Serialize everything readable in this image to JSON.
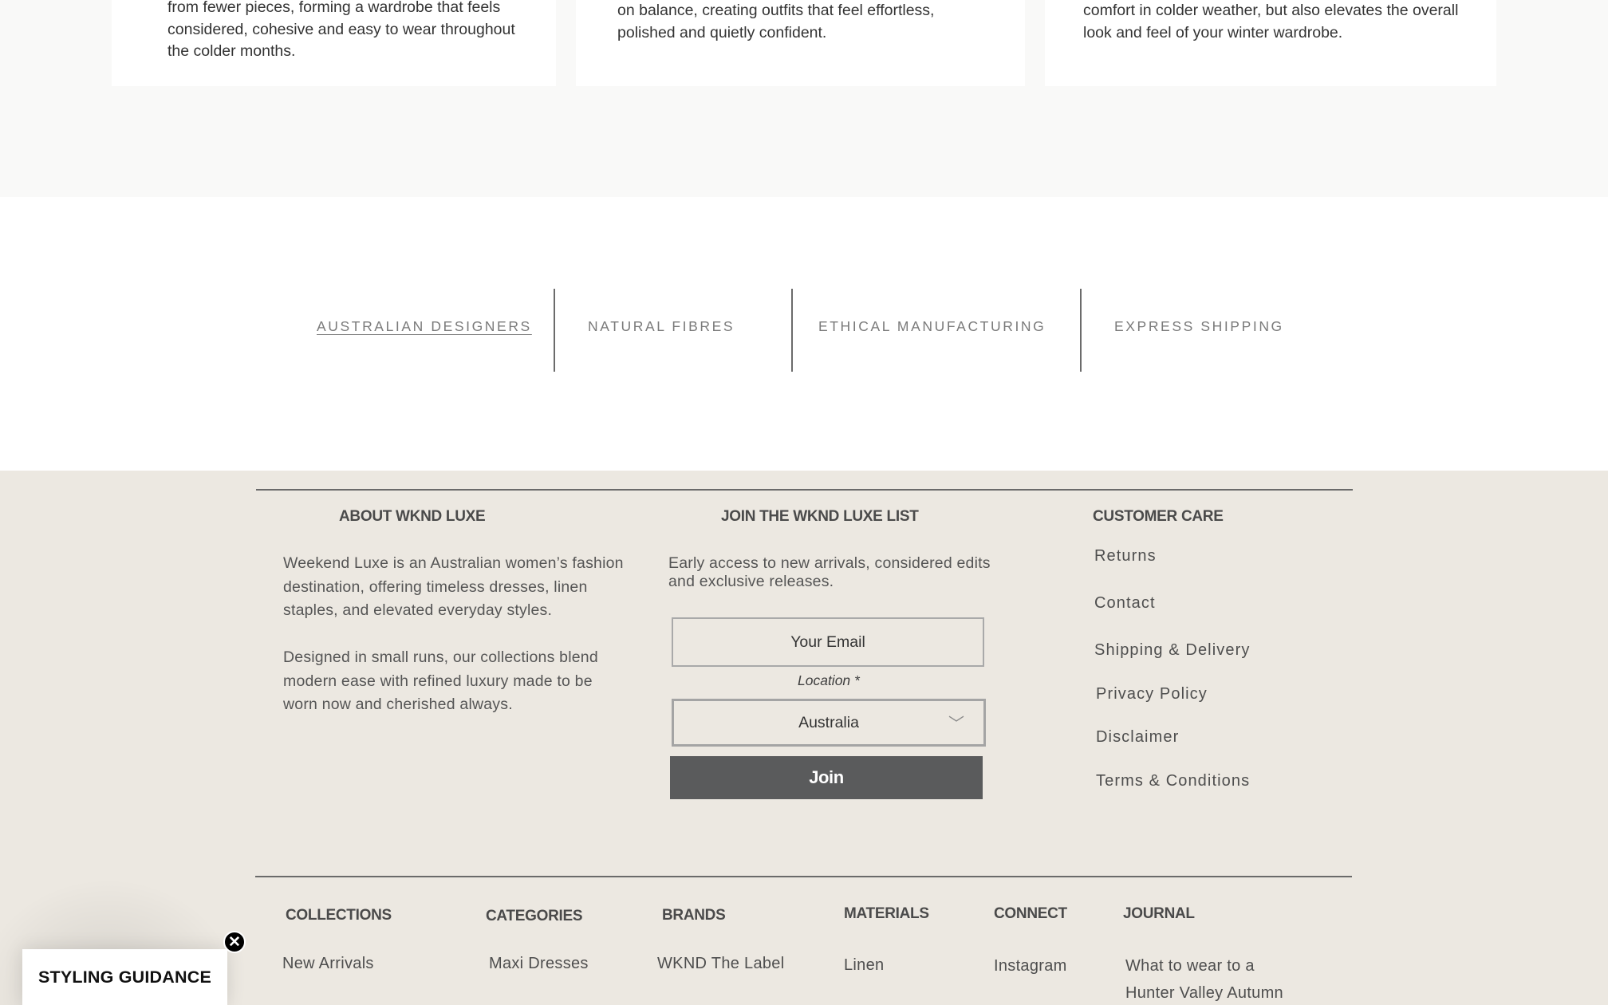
{
  "cards": [
    {
      "text": "from fewer pieces, forming a wardrobe that feels considered, cohesive and easy to wear throughout the colder months."
    },
    {
      "text": "on balance, creating outfits that feel effortless, polished and quietly confident."
    },
    {
      "text": "comfort in colder weather, but also elevates the overall look and feel of your winter wardrobe."
    }
  ],
  "trust_bar": [
    "AUSTRALIAN DESIGNERS",
    "NATURAL FIBRES",
    "ETHICAL MANUFACTURING",
    "EXPRESS SHIPPING"
  ],
  "about": {
    "heading": "ABOUT WKND LUXE",
    "para1": "Weekend Luxe is an Australian women’s fashion destination, offering timeless dresses, linen staples, and elevated everyday styles.",
    "para2": "Designed in small runs, our collections blend modern ease with refined luxury made to be worn now and cherished always."
  },
  "newsletter": {
    "heading": "JOIN THE WKND LUXE LIST",
    "text": "Early access to new arrivals, considered edits and exclusive releases.",
    "email_placeholder": "Your Email",
    "location_label": "Location *",
    "location_value": "Australia",
    "join_label": "Join"
  },
  "customer_care": {
    "heading": "CUSTOMER CARE",
    "links": [
      "Returns",
      "Contact",
      "Shipping & Delivery",
      "Privacy Policy",
      "Disclaimer",
      "Terms & Conditions"
    ]
  },
  "footer_nav": {
    "collections": {
      "heading": "COLLECTIONS",
      "link": "New Arrivals"
    },
    "categories": {
      "heading": "CATEGORIES",
      "link": "Maxi Dresses"
    },
    "brands": {
      "heading": "BRANDS",
      "link": "WKND The Label"
    },
    "materials": {
      "heading": "MATERIALS",
      "link": "Linen"
    },
    "connect": {
      "heading": "CONNECT",
      "link": "Instagram"
    },
    "journal": {
      "heading": "JOURNAL",
      "link_line1": "What to wear to a",
      "link_line2": "Hunter Valley Autumn"
    }
  },
  "styling_widget": {
    "label": "STYLING GUIDANCE",
    "close": "✕"
  },
  "icons": {
    "chevron": "chevron-down-icon",
    "close": "close-icon"
  }
}
